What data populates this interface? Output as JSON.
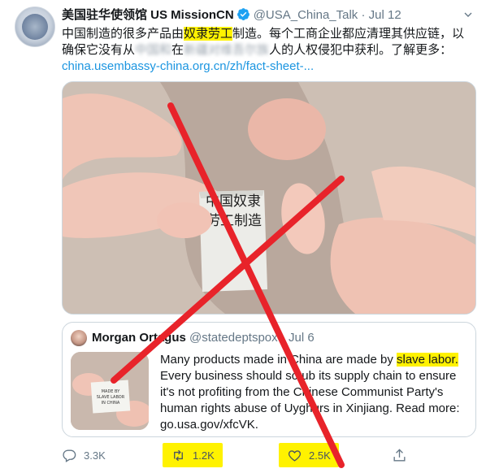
{
  "tweet": {
    "author": {
      "name": "美国驻华使领馆 US MissionCN",
      "handle": "@USA_China_Talk",
      "separator": "·",
      "date": "Jul 12"
    },
    "text": {
      "part1": "中国制造的很多产品由",
      "highlight": "奴隶劳工",
      "part2": "制造。每个工商企业都应清理其供应链，以确保它没有从",
      "blur1": "中国和",
      "part3": "在",
      "blur2": "新疆对维吾尔族",
      "part4": "人的人权侵犯中获利。了解更多：",
      "link": "china.usembassy-china.org.cn/zh/fact-sheet-..."
    },
    "image_label": "中国奴隶\n劳工制造"
  },
  "quote": {
    "name": "Morgan Ortagus",
    "handle": "@statedeptspox",
    "separator": "·",
    "date": "Jul 6",
    "thumb_label": "MADE BY\nSLAVE LABOR\nIN CHINA",
    "text": {
      "part1": "Many products made in China are made by ",
      "highlight": "slave labor.",
      "part2": " Every business should scrub its supply chain to ensure it's not profiting from the Chinese Communist Party's human rights abuse of Uyghurs in Xinjiang. Read more: go.usa.gov/xfcVK."
    }
  },
  "actions": {
    "replies": "3.3K",
    "retweets": "1.2K",
    "likes": "2.5K"
  },
  "colors": {
    "highlight": "#fff200",
    "link": "#1b95e0",
    "cross": "#e8232a",
    "muted": "#657786"
  },
  "icons": {
    "verified": "verified-badge-icon",
    "caret": "chevron-down-icon",
    "reply": "reply-icon",
    "retweet": "retweet-icon",
    "like": "heart-icon",
    "share": "share-icon"
  }
}
